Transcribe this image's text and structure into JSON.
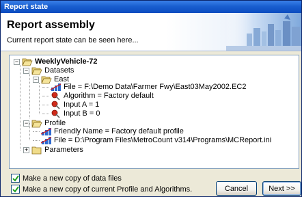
{
  "window": {
    "title": "Report state"
  },
  "header": {
    "title": "Report assembly",
    "subtitle": "Current report state can be seen here..."
  },
  "tree": {
    "root": "WeeklyVehicle-72",
    "datasets": "Datasets",
    "east": "East",
    "east_file": "File = F:\\Demo Data\\Farmer Fwy\\East03May2002.EC2",
    "algorithm": "Algorithm = Factory default",
    "input_a": "Input A = 1",
    "input_b": "Input B = 0",
    "profile": "Profile",
    "friendly_name": "Friendly Name = Factory default profile",
    "profile_file": "File = D:\\Program Files\\MetroCount v314\\Programs\\MCReport.ini",
    "parameters": "Parameters"
  },
  "options": {
    "copy_data_files": {
      "label": "Make a new copy of data files",
      "checked": true
    },
    "copy_profile": {
      "label": "Make a new copy of current Profile and Algorithms.",
      "checked": true
    }
  },
  "buttons": {
    "cancel": "Cancel",
    "next": "Next >>"
  },
  "icons": {
    "expanded": "minus-expander-icon",
    "collapsed": "plus-expander-icon",
    "folder_open": "open-folder-icon",
    "folder_closed": "closed-folder-icon",
    "file": "file-tool-icon",
    "setting": "red-pin-icon"
  },
  "colors": {
    "title_bar": "#0b4cc0",
    "tree_border": "#7f9db9",
    "dialog_bg": "#ece9d8"
  }
}
